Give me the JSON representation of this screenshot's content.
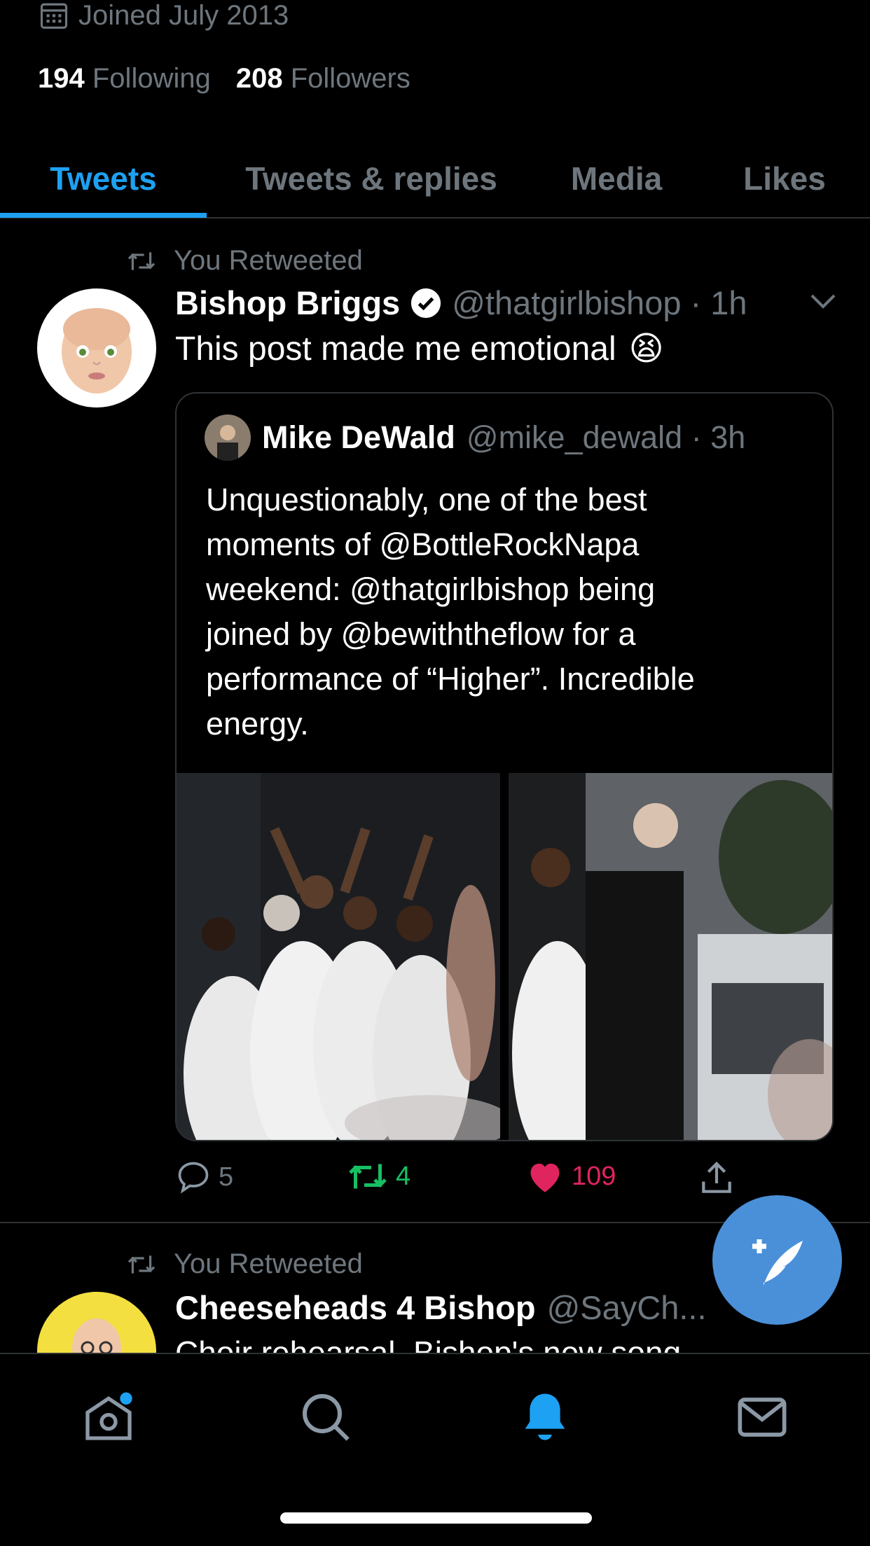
{
  "profile": {
    "joined": "Joined July 2013",
    "following_count": "194",
    "following_label": "Following",
    "followers_count": "208",
    "followers_label": "Followers"
  },
  "tabs": [
    {
      "label": "Tweets",
      "active": true
    },
    {
      "label": "Tweets & replies",
      "active": false
    },
    {
      "label": "Media",
      "active": false
    },
    {
      "label": "Likes",
      "active": false
    }
  ],
  "tweet1": {
    "retweet_label": "You Retweeted",
    "name": "Bishop Briggs",
    "handle_time": "@thatgirlbishop · 1h",
    "text": "This post made me emotional",
    "emoji": "😫",
    "quote": {
      "name": "Mike DeWald",
      "handle_time": "@mike_dewald · 3h",
      "lines": [
        "Unquestionably, one of the best",
        "moments of @BottleRockNapa",
        "weekend: @thatgirlbishop being",
        "joined by @bewiththeflow for a",
        "performance of “Higher”. Incredible",
        "energy."
      ]
    },
    "replies": "5",
    "retweets": "4",
    "likes": "109"
  },
  "tweet2": {
    "retweet_label": "You Retweeted",
    "name": "Cheeseheads 4 Bishop",
    "handle": "@SayCh...",
    "text": "Choir rehearsal. Bishop's new song"
  },
  "colors": {
    "accent": "#1da1f2",
    "retweet": "#17bf63",
    "like": "#e0245e",
    "muted": "#6e767d"
  }
}
